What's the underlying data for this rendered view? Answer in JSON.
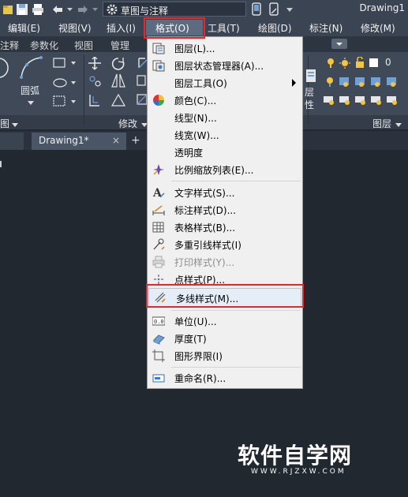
{
  "quick_access": {
    "workspace": "草图与注释",
    "app_title": "Drawing1"
  },
  "menubar": {
    "items": [
      "编辑(E)",
      "视图(V)",
      "插入(I)",
      "格式(O)",
      "工具(T)",
      "绘图(D)",
      "标注(N)",
      "修改(M)"
    ]
  },
  "ribbon_tabs": [
    "注释",
    "参数化",
    "视图",
    "管理"
  ],
  "ribbon": {
    "arc_label": "圆弧",
    "modify_label": "修改",
    "layers_label": "图层",
    "draw_panel_label": "图",
    "layer_value": "0",
    "layer_side_label_1": "层",
    "layer_side_label_2": "性"
  },
  "doc_tab": {
    "name": "Drawing1*",
    "close": "×",
    "new_tab": "+"
  },
  "format_menu": {
    "items": [
      {
        "label": "图层(L)...",
        "icon": "layers-icon"
      },
      {
        "label": "图层状态管理器(A)...",
        "icon": "layer-states-icon"
      },
      {
        "label": "图层工具(O)",
        "icon": "",
        "submenu": true
      },
      {
        "label": "颜色(C)...",
        "icon": "color-wheel-icon"
      },
      {
        "label": "线型(N)...",
        "icon": ""
      },
      {
        "label": "线宽(W)...",
        "icon": ""
      },
      {
        "label": "透明度",
        "icon": ""
      },
      {
        "label": "比例缩放列表(E)...",
        "icon": "scale-list-icon"
      },
      {
        "label": "文字样式(S)...",
        "icon": "text-style-icon"
      },
      {
        "label": "标注样式(D)...",
        "icon": "dim-style-icon"
      },
      {
        "label": "表格样式(B)...",
        "icon": "table-style-icon"
      },
      {
        "label": "多重引线样式(I)",
        "icon": "mleader-style-icon"
      },
      {
        "label": "打印样式(Y)...",
        "icon": "plot-style-icon",
        "disabled": true
      },
      {
        "label": "点样式(P)...",
        "icon": "point-style-icon"
      },
      {
        "label": "多线样式(M)...",
        "icon": "mline-style-icon",
        "highlighted": true
      },
      {
        "label": "单位(U)...",
        "icon": "units-icon"
      },
      {
        "label": "厚度(T)",
        "icon": "thickness-icon"
      },
      {
        "label": "图形界限(I)",
        "icon": "limits-icon"
      },
      {
        "label": "重命名(R)...",
        "icon": "rename-icon"
      }
    ]
  },
  "watermark": {
    "title": "软件自学网",
    "url": "WWW.RJZXW.COM"
  },
  "colors": {
    "highlight_box": "#e8262d",
    "menu_bg": "#f0f0f0",
    "canvas_bg": "#212830"
  }
}
